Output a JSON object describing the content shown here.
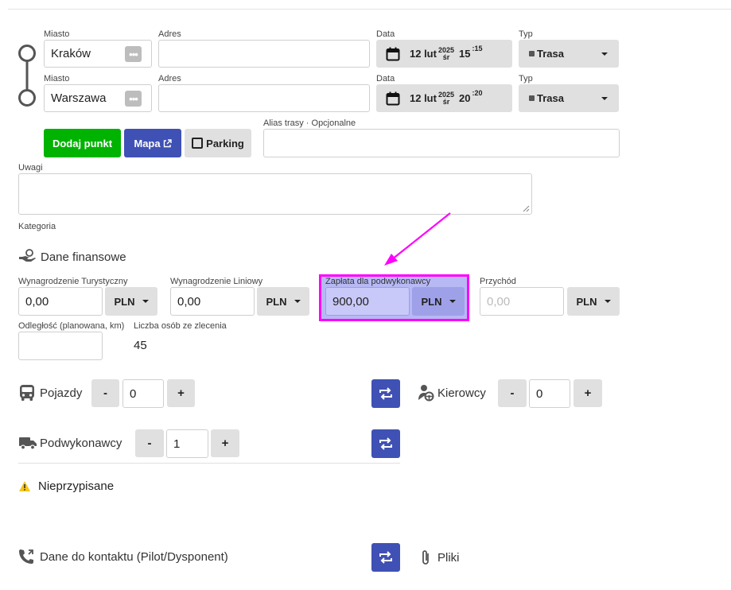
{
  "route": {
    "points": [
      {
        "miasto_label": "Miasto",
        "miasto": "Kraków",
        "adres_label": "Adres",
        "adres": "",
        "data_label": "Data",
        "day": "12 lut",
        "year": "2025",
        "weekday": "śr",
        "hour": "15",
        "minute": ":15",
        "typ_label": "Typ",
        "typ": "Trasa"
      },
      {
        "miasto_label": "Miasto",
        "miasto": "Warszawa",
        "adres_label": "Adres",
        "adres": "",
        "data_label": "Data",
        "day": "12 lut",
        "year": "2025",
        "weekday": "śr",
        "hour": "20",
        "minute": ":20",
        "typ_label": "Typ",
        "typ": "Trasa"
      }
    ],
    "add_point_label": "Dodaj punkt",
    "map_label": "Mapa",
    "parking_label": "Parking",
    "alias_label": "Alias trasy · Opcjonalne",
    "alias_value": ""
  },
  "uwagi": {
    "label": "Uwagi",
    "value": ""
  },
  "kategoria_label": "Kategoria",
  "finance": {
    "title": "Dane finansowe",
    "fields": [
      {
        "label": "Wynagrodzenie Turystyczny",
        "value": "0,00",
        "currency": "PLN"
      },
      {
        "label": "Wynagrodzenie Liniowy",
        "value": "0,00",
        "currency": "PLN"
      },
      {
        "label": "Zapłata dla podwykonawcy",
        "value": "900,00",
        "currency": "PLN"
      },
      {
        "label": "Przychód",
        "placeholder": "0,00",
        "currency": "PLN"
      }
    ],
    "distance_label": "Odległość (planowana, km)",
    "distance_value": "",
    "persons_label": "Liczba osób ze zlecenia",
    "persons_value": "45"
  },
  "vehicles": {
    "label": "Pojazdy",
    "minus": "-",
    "value": "0",
    "plus": "+"
  },
  "drivers": {
    "label": "Kierowcy",
    "minus": "-",
    "value": "0",
    "plus": "+"
  },
  "subcontractors": {
    "label": "Podwykonawcy",
    "minus": "-",
    "value": "1",
    "plus": "+"
  },
  "unassigned_label": "Nieprzypisane",
  "contact_label": "Dane do kontaktu (Pilot/Dysponent)",
  "files_label": "Pliki",
  "colors": {
    "green": "#00b300",
    "blue": "#3f51b5",
    "highlight": "#ff00ff",
    "warning": "#f5c518"
  }
}
